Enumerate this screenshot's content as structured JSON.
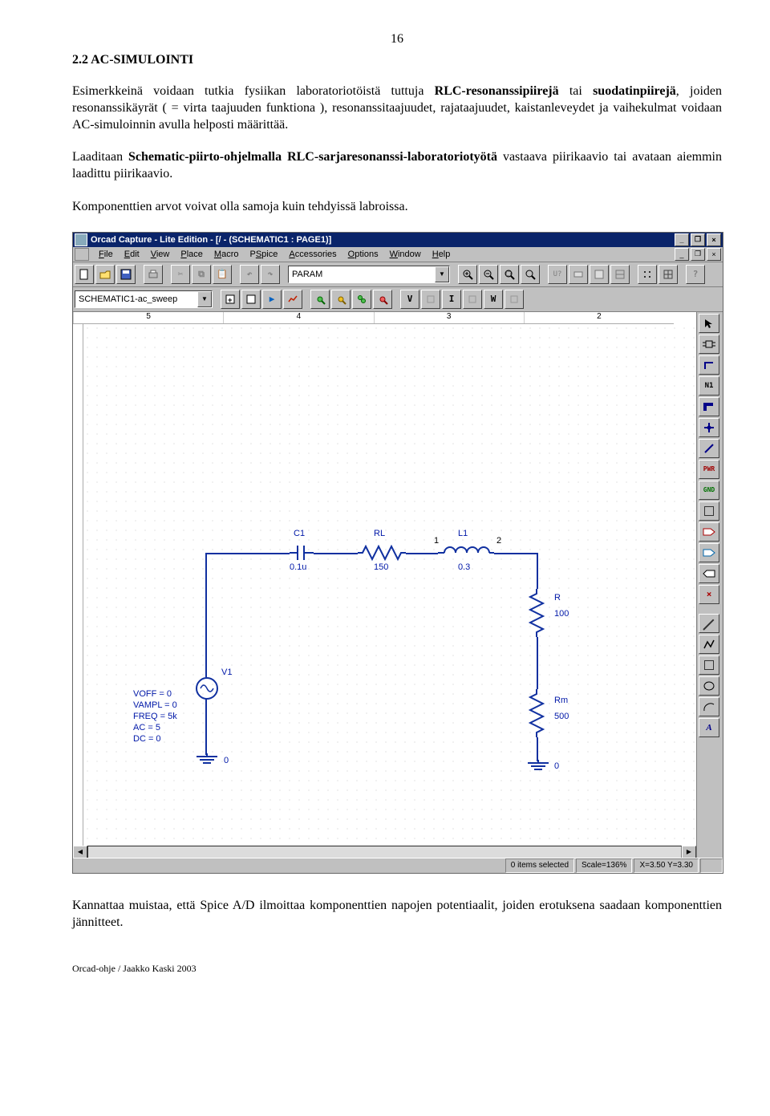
{
  "page_number": "16",
  "heading": "2.2 AC-SIMULOINTI",
  "para1_plain_pre": "Esimerkkeinä voidaan tutkia fysiikan laboratoriotöistä tuttuja ",
  "para1_bold1": "RLC-resonanssipiirejä",
  "para1_mid1": " tai ",
  "para1_bold2": "suodatinpiirejä",
  "para1_post": ", joiden resonanssikäyrät ( = virta taajuuden funktiona ), resonanssitaajuudet, rajataajuudet, kaistanleveydet ja vaihekulmat voidaan AC-simuloinnin avulla helposti määrittää.",
  "para2_pre": "Laaditaan ",
  "para2_bold1": "Schematic-piirto-ohjelmalla",
  "para2_mid1": " ",
  "para2_bold2": "RLC-sarjaresonanssi-laboratoriotyötä",
  "para2_post": " vastaava piirikaavio tai avataan aiemmin laadittu piirikaavio.",
  "para3": "Komponenttien arvot voivat olla samoja kuin tehdyissä labroissa.",
  "para4": "Kannattaa muistaa, että Spice A/D ilmoittaa komponenttien napojen potentiaalit, joiden erotuksena saadaan komponenttien jännitteet.",
  "footer": "Orcad-ohje / Jaakko Kaski 2003",
  "app": {
    "title": "Orcad Capture - Lite Edition - [/ - (SCHEMATIC1 : PAGE1)]",
    "menus": [
      "File",
      "Edit",
      "View",
      "Place",
      "Macro",
      "PSpice",
      "Accessories",
      "Options",
      "Window",
      "Help"
    ],
    "partbox": "PARAM",
    "schembox": "SCHEMATIC1-ac_sweep",
    "ruler_numbers": [
      "5",
      "4",
      "3",
      "2"
    ],
    "status_items": "0 items selected",
    "status_scale": "Scale=136%",
    "status_xy": "X=3.50 Y=3.30"
  },
  "circuit": {
    "V1": {
      "name": "V1",
      "params": [
        "VOFF = 0",
        "VAMPL = 0",
        "FREQ = 5k",
        "AC = 5",
        "DC = 0"
      ],
      "gnd": "0"
    },
    "C1": {
      "name": "C1",
      "value": "0.1u"
    },
    "RL": {
      "name": "RL",
      "value": "150"
    },
    "L1": {
      "name": "L1",
      "value": "0.3",
      "n1": "1",
      "n2": "2"
    },
    "R": {
      "name": "R",
      "value": "100"
    },
    "Rm": {
      "name": "Rm",
      "value": "500",
      "gnd": "0"
    }
  }
}
